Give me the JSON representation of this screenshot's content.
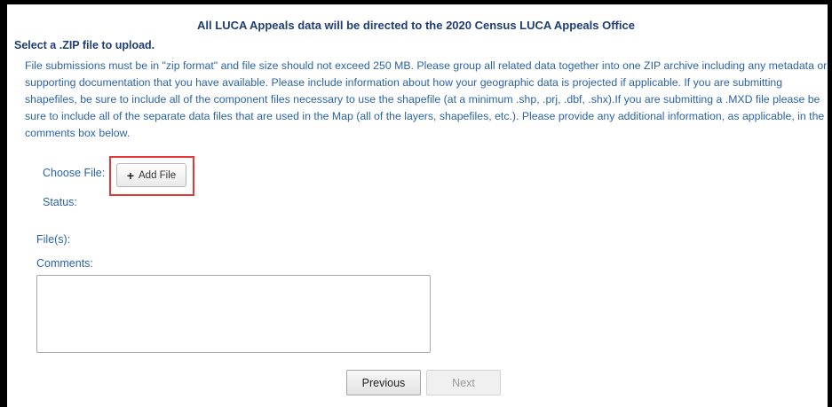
{
  "header": {
    "title": "All LUCA Appeals data will be directed to the 2020 Census LUCA Appeals Office"
  },
  "upload": {
    "section_title": "Select a .ZIP file to upload.",
    "instructions": "File submissions must be in \"zip format\" and file size should not exceed 250 MB. Please group all related data together into one ZIP archive including any metadata or supporting documentation that you have available. Please include information about how your geographic data is projected if applicable. If you are submitting shapefiles, be sure to include all of the component files necessary to use the shapefile (at a minimum .shp, .prj, .dbf, .shx).If you are submitting a .MXD file please be sure to include all of the separate data files that are used in the Map (all of the layers, shapefiles, etc.). Please provide any additional information, as applicable, in the comments box below.",
    "choose_file_label": "Choose File:",
    "add_file_icon": "+",
    "add_file_label": "Add File",
    "status_label": "Status:",
    "files_label": "File(s):",
    "comments_label": "Comments:",
    "comments_value": ""
  },
  "nav": {
    "previous_label": "Previous",
    "next_label": "Next"
  },
  "colors": {
    "heading": "#1f3d73",
    "text": "#2a63a8",
    "highlight": "#e03a3a"
  }
}
